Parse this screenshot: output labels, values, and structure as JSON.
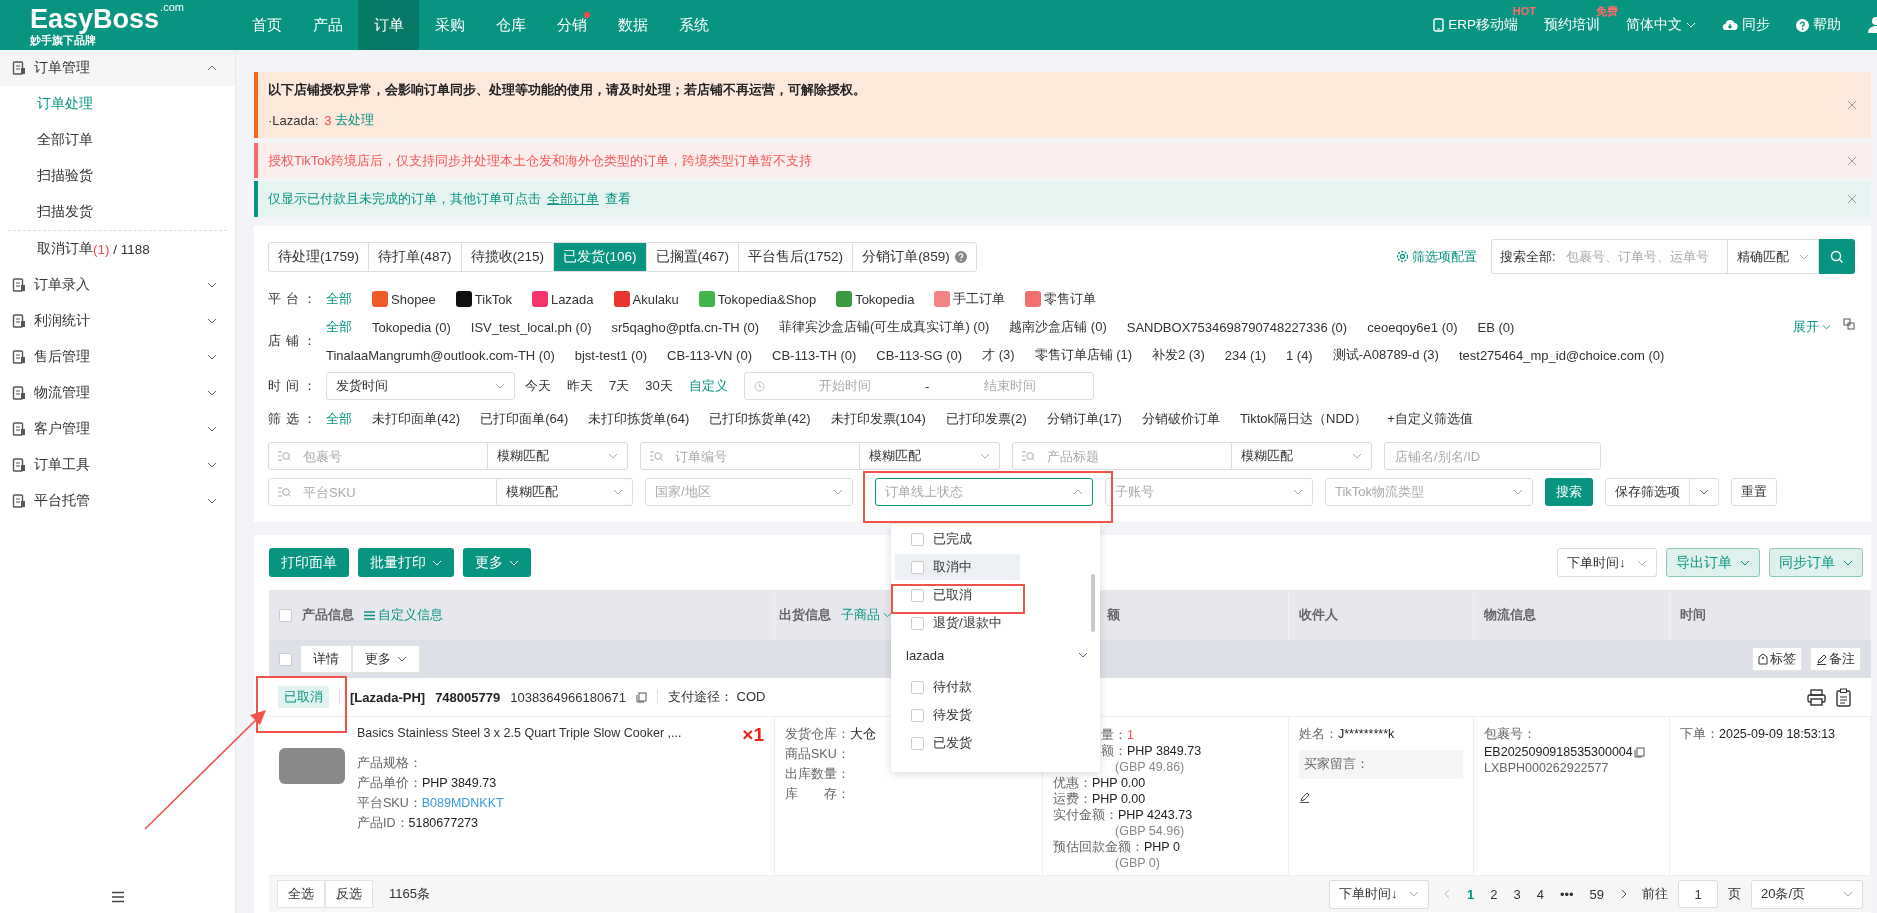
{
  "topbar": {
    "logo": "EasyBoss",
    "logo_suffix": ".com",
    "tagline": "妙手旗下品牌",
    "nav": [
      {
        "label": "首页",
        "selected": false,
        "dot": false
      },
      {
        "label": "产品",
        "selected": false,
        "dot": false
      },
      {
        "label": "订单",
        "selected": true,
        "dot": false
      },
      {
        "label": "采购",
        "selected": false,
        "dot": false
      },
      {
        "label": "仓库",
        "selected": false,
        "dot": false
      },
      {
        "label": "分销",
        "selected": false,
        "dot": true
      },
      {
        "label": "数据",
        "selected": false,
        "dot": false
      },
      {
        "label": "系统",
        "selected": false,
        "dot": false
      }
    ],
    "tools": [
      {
        "kind": "mobile",
        "label": "ERP移动端",
        "badge": "HOT"
      },
      {
        "kind": "plain",
        "label": "预约培训",
        "badge": "免费"
      },
      {
        "kind": "lang",
        "label": "简体中文"
      },
      {
        "kind": "sync",
        "label": "同步"
      },
      {
        "kind": "help",
        "label": "帮助"
      }
    ]
  },
  "sidebar": {
    "groups": [
      {
        "label": "订单管理",
        "expanded": true,
        "children": [
          {
            "label": "订单处理",
            "selected": true
          },
          {
            "label": "全部订单",
            "selected": false
          },
          {
            "label": "扫描验货",
            "selected": false
          },
          {
            "label": "扫描发货",
            "selected": false
          },
          {
            "label": "取消订单",
            "count": "(1)",
            "total": "/ 1188",
            "selected": false
          }
        ]
      },
      {
        "label": "订单录入",
        "expanded": false
      },
      {
        "label": "利润统计",
        "expanded": false
      },
      {
        "label": "售后管理",
        "expanded": false
      },
      {
        "label": "物流管理",
        "expanded": false
      },
      {
        "label": "客户管理",
        "expanded": false
      },
      {
        "label": "订单工具",
        "expanded": false
      },
      {
        "label": "平台托管",
        "expanded": false
      }
    ]
  },
  "alerts": [
    {
      "kind": "warning",
      "title": "以下店铺授权异常，会影响订单同步、处理等功能的使用，请及时处理；若店铺不再运营，可解除授权。",
      "platform": "·Lazada:",
      "count": "3",
      "link": "去处理"
    },
    {
      "kind": "error",
      "text": "授权TikTok跨境店后，仅支持同步并处理本土仓发和海外仓类型的订单，跨境类型订单暂不支持"
    },
    {
      "kind": "info",
      "text": "仅显示已付款且未完成的订单，其他订单可点击",
      "link": "全部订单",
      "after": "查看"
    }
  ],
  "tabs": [
    {
      "label": "待处理(1759)",
      "selected": false,
      "help": false
    },
    {
      "label": "待打单(487)",
      "selected": false,
      "help": false
    },
    {
      "label": "待揽收(215)",
      "selected": false,
      "help": false
    },
    {
      "label": "已发货(106)",
      "selected": true,
      "help": false
    },
    {
      "label": "已搁置(467)",
      "selected": false,
      "help": false
    },
    {
      "label": "平台售后(1752)",
      "selected": false,
      "help": false
    },
    {
      "label": "分销订单(859)",
      "selected": false,
      "help": true
    }
  ],
  "search": {
    "config_link": "筛选项配置",
    "label": "搜索全部:",
    "placeholder": "包裹号、订单号、运单号",
    "match": "精确匹配"
  },
  "platform_row": {
    "label": "平台：",
    "options": [
      {
        "kind": "all",
        "label": "全部",
        "selected": true
      },
      {
        "kind": "platform",
        "label": "Shopee",
        "color": "#f05a28",
        "selected": false
      },
      {
        "kind": "platform",
        "label": "TikTok",
        "color": "#111111",
        "selected": false
      },
      {
        "kind": "platform",
        "label": "Lazada",
        "color": "#f5346b",
        "selected": false
      },
      {
        "kind": "platform",
        "label": "Akulaku",
        "color": "#e8352e",
        "selected": false
      },
      {
        "kind": "platform",
        "label": "Tokopedia&Shop",
        "color": "#42b549",
        "selected": false
      },
      {
        "kind": "platform",
        "label": "Tokopedia",
        "color": "#3a9a3f",
        "selected": false
      },
      {
        "kind": "platform",
        "label": "手工订单",
        "color": "#f48484",
        "selected": false
      },
      {
        "kind": "platform",
        "label": "零售订单",
        "color": "#f27070",
        "selected": false
      }
    ]
  },
  "store_row": {
    "label": "店铺：",
    "expand": "展开",
    "options": [
      {
        "label": "全部",
        "selected": true
      },
      {
        "label": "Tokopedia (0)",
        "selected": false
      },
      {
        "label": "ISV_test_local.ph (0)",
        "selected": false
      },
      {
        "label": "sr5qagho@ptfa.cn-TH (0)",
        "selected": false
      },
      {
        "label": "菲律宾沙盒店铺(可生成真实订单) (0)",
        "selected": false
      },
      {
        "label": "越南沙盒店铺 (0)",
        "selected": false
      },
      {
        "label": "SANDBOX7534698790748227336 (0)",
        "selected": false
      },
      {
        "label": "ceoeqoy6e1 (0)",
        "selected": false
      },
      {
        "label": "EB (0)",
        "selected": false
      },
      {
        "label": "TinalaaMangrumh@outlook.com-TH (0)",
        "selected": false
      },
      {
        "label": "bjst-test1 (0)",
        "selected": false
      },
      {
        "label": "CB-113-VN (0)",
        "selected": false
      },
      {
        "label": "CB-113-TH (0)",
        "selected": false
      },
      {
        "label": "CB-113-SG (0)",
        "selected": false
      },
      {
        "label": "才 (3)",
        "selected": false
      },
      {
        "label": "零售订单店铺 (1)",
        "selected": false
      },
      {
        "label": "补发2 (3)",
        "selected": false
      },
      {
        "label": "234 (1)",
        "selected": false
      },
      {
        "label": "1 (4)",
        "selected": false
      },
      {
        "label": "测试-A08789-d (3)",
        "selected": false
      },
      {
        "label": "test275464_mp_id@choice.com (0)",
        "selected": false
      }
    ]
  },
  "time_row": {
    "label": "时间：",
    "field": "发货时间",
    "quick": [
      {
        "kind": "preset",
        "label": "今天"
      },
      {
        "kind": "preset",
        "label": "昨天"
      },
      {
        "kind": "preset",
        "label": "7天"
      },
      {
        "kind": "preset",
        "label": "30天"
      },
      {
        "kind": "link",
        "label": "自定义"
      }
    ],
    "start_placeholder": "开始时间",
    "separator": "-",
    "end_placeholder": "结束时间"
  },
  "filter_row": {
    "label": "筛选：",
    "options": [
      {
        "label": "全部",
        "selected": true
      },
      {
        "label": "未打印面单(42)",
        "selected": false
      },
      {
        "label": "已打印面单(64)",
        "selected": false
      },
      {
        "label": "未打印拣货单(64)",
        "selected": false
      },
      {
        "label": "已打印拣货单(42)",
        "selected": false
      },
      {
        "label": "未打印发票(104)",
        "selected": false
      },
      {
        "label": "已打印发票(2)",
        "selected": false
      },
      {
        "label": "分销订单(17)",
        "selected": false
      },
      {
        "label": "分销破价订单",
        "selected": false
      },
      {
        "label": "Tiktok隔日达（NDD）",
        "selected": false
      }
    ],
    "add_link": "+自定义筛选值"
  },
  "field_rows": [
    [
      {
        "kind": "search",
        "placeholder": "包裹号",
        "match": "模糊匹配"
      },
      {
        "kind": "search",
        "placeholder": "订单编号",
        "match": "模糊匹配"
      },
      {
        "kind": "search",
        "placeholder": "产品标题",
        "match": "模糊匹配"
      },
      {
        "kind": "text",
        "placeholder": "店铺名/别名/ID"
      }
    ],
    [
      {
        "kind": "search",
        "placeholder": "平台SKU",
        "match": "模糊匹配"
      },
      {
        "kind": "select",
        "placeholder": "国家/地区",
        "open": false
      },
      {
        "kind": "select",
        "placeholder": "订单线上状态",
        "open": true
      },
      {
        "kind": "select",
        "placeholder": "子账号",
        "open": false
      },
      {
        "kind": "select",
        "placeholder": "TikTok物流类型",
        "open": false
      }
    ]
  ],
  "filter_buttons": {
    "search": "搜索",
    "save": "保存筛选项",
    "reset": "重置"
  },
  "status_dropdown": [
    {
      "kind": "option",
      "label": "已完成",
      "checked": false,
      "hovered": false
    },
    {
      "kind": "option",
      "label": "取消中",
      "checked": false,
      "hovered": true
    },
    {
      "kind": "option",
      "label": "已取消",
      "checked": false,
      "hovered": false
    },
    {
      "kind": "option",
      "label": "退货/退款中",
      "checked": false,
      "hovered": false
    },
    {
      "kind": "group",
      "label": "lazada"
    },
    {
      "kind": "option",
      "label": "待付款",
      "checked": false,
      "hovered": false
    },
    {
      "kind": "option",
      "label": "待发货",
      "checked": false,
      "hovered": false
    },
    {
      "kind": "option",
      "label": "已发货",
      "checked": false,
      "hovered": false
    }
  ],
  "actions": {
    "left": [
      {
        "label": "打印面单",
        "caret": false
      },
      {
        "label": "批量打印",
        "caret": true
      },
      {
        "label": "更多",
        "caret": true
      }
    ],
    "sort": "下单时间↓",
    "right": [
      {
        "label": "导出订单"
      },
      {
        "label": "同步订单"
      }
    ]
  },
  "table": {
    "select_all": {
      "checked": false
    },
    "columns": [
      {
        "label": "产品信息",
        "link": "自定义信息"
      },
      {
        "label": "出货信息",
        "link": "子商品"
      },
      {
        "label": "额"
      },
      {
        "label": "收件人"
      },
      {
        "label": "物流信息"
      },
      {
        "label": "时间"
      }
    ],
    "order": {
      "checked": false,
      "detail_button": "详情",
      "more_button": "更多",
      "tag_button": "标签",
      "note_button": "备注",
      "status": "已取消",
      "shop": "[Lazada-PH]",
      "order_no": "748005779",
      "platform_no": "1038364966180671",
      "payment_label": "支付途径：",
      "payment": "COD",
      "product": {
        "title": "Basics Stainless Steel 3 x 2.5 Quart Triple Slow Cooker ,...",
        "spec_label": "产品规格：",
        "price_label": "产品单价：",
        "price": "PHP 3849.73",
        "sku_label": "平台SKU：",
        "sku": "B089MDNKKT",
        "id_label": "产品ID：",
        "id": "5180677273",
        "qty": "×1"
      },
      "shipping": [
        {
          "label": "发货仓库：",
          "value": "大仓"
        },
        {
          "label": "商品SKU："
        },
        {
          "label": "出库数量："
        },
        {
          "label": "库　　存："
        }
      ],
      "amounts": [
        {
          "label": "量：",
          "value": "1",
          "kind": "count"
        },
        {
          "label": "额：",
          "value": "PHP 3849.73",
          "sub": "(GBP 49.86)",
          "kind": "money"
        },
        {
          "label": "优惠：",
          "value": "PHP 0.00",
          "kind": "money"
        },
        {
          "label": "运费：",
          "value": "PHP 0.00",
          "kind": "money"
        },
        {
          "label": "实付金额：",
          "value": "PHP 4243.73",
          "sub": "(GBP 54.96)",
          "kind": "money"
        },
        {
          "label": "预估回款金额：",
          "value": "PHP 0",
          "sub": "(GBP 0)",
          "kind": "money"
        }
      ],
      "recipient": {
        "name_label": "姓名：",
        "name": "J*********k",
        "message_label": "买家留言："
      },
      "logistics": {
        "label": "包裹号：",
        "package_no": "EB2025090918535300004",
        "tracking_no": "LXBPH000262922577"
      },
      "time": {
        "label": "下单：",
        "value": "2025-09-09 18:53:13"
      }
    }
  },
  "footer": {
    "select_all": "全选",
    "invert": "反选",
    "total": "1165条",
    "sort": "下单时间↓",
    "pages": [
      {
        "label": "1",
        "selected": true
      },
      {
        "label": "2",
        "selected": false
      },
      {
        "label": "3",
        "selected": false
      },
      {
        "label": "4",
        "selected": false
      }
    ],
    "ellipsis": "•••",
    "last_page": "59",
    "goto_label": "前往",
    "goto_value": "1",
    "page_unit": "页",
    "page_size": "20条/页"
  }
}
